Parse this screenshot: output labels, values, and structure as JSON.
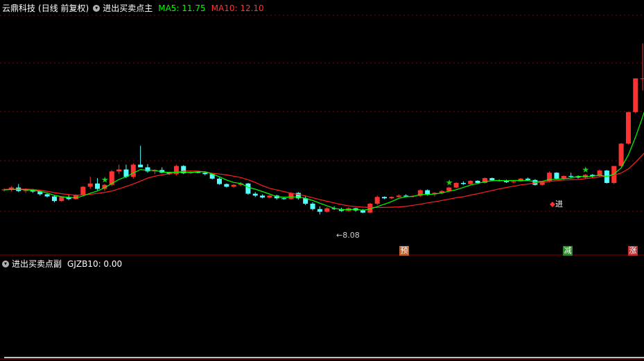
{
  "main_header": {
    "stock": "云鼎科技",
    "period": "(日线 前复权)",
    "indicator": "进出买卖点主",
    "ma5": "MA5: 11.75",
    "ma10": "MA10: 12.10"
  },
  "sub_header": {
    "indicator": "进出买卖点副",
    "value": "GJZB10: 0.00"
  },
  "annotations": {
    "low_price": "←8.08",
    "buy_label": "进",
    "tag_yu": "预",
    "tag_jian": "减",
    "tag_zhang": "涨"
  },
  "colors": {
    "up": "#ff3232",
    "down": "#54ffff",
    "ma5": "#00ff00",
    "ma10": "#ff2020",
    "grid": "#8b0000",
    "signal": "#ffff00"
  },
  "chart_data": {
    "type": "candlestick",
    "ohlc": [
      [
        9.95,
        10.02,
        9.9,
        9.98
      ],
      [
        9.98,
        10.1,
        9.9,
        10.05
      ],
      [
        10.05,
        10.18,
        9.88,
        9.92
      ],
      [
        9.92,
        10.02,
        9.85,
        9.95
      ],
      [
        9.95,
        10.0,
        9.85,
        9.9
      ],
      [
        9.9,
        9.92,
        9.75,
        9.8
      ],
      [
        9.8,
        9.82,
        9.68,
        9.72
      ],
      [
        9.72,
        9.75,
        9.5,
        9.55
      ],
      [
        9.55,
        9.72,
        9.52,
        9.7
      ],
      [
        9.7,
        9.78,
        9.58,
        9.62
      ],
      [
        9.62,
        9.8,
        9.6,
        9.78
      ],
      [
        9.78,
        10.1,
        9.75,
        10.08
      ],
      [
        10.08,
        10.45,
        10.0,
        10.2
      ],
      [
        10.2,
        10.4,
        9.95,
        10.0
      ],
      [
        10.0,
        10.18,
        9.92,
        10.15
      ],
      [
        10.15,
        10.7,
        10.1,
        10.65
      ],
      [
        10.65,
        10.9,
        10.55,
        10.72
      ],
      [
        10.72,
        10.9,
        10.4,
        10.45
      ],
      [
        10.45,
        10.95,
        10.38,
        10.9
      ],
      [
        10.9,
        11.6,
        10.8,
        10.8
      ],
      [
        10.8,
        10.92,
        10.6,
        10.65
      ],
      [
        10.65,
        10.72,
        10.55,
        10.7
      ],
      [
        10.7,
        10.8,
        10.58,
        10.6
      ],
      [
        10.6,
        10.62,
        10.52,
        10.55
      ],
      [
        10.55,
        10.9,
        10.5,
        10.85
      ],
      [
        10.85,
        10.88,
        10.55,
        10.58
      ],
      [
        10.58,
        10.65,
        10.55,
        10.62
      ],
      [
        10.62,
        10.65,
        10.58,
        10.6
      ],
      [
        10.6,
        10.62,
        10.5,
        10.55
      ],
      [
        10.55,
        10.58,
        10.35,
        10.38
      ],
      [
        10.38,
        10.42,
        10.15,
        10.18
      ],
      [
        10.18,
        10.2,
        10.05,
        10.08
      ],
      [
        10.08,
        10.18,
        10.05,
        10.15
      ],
      [
        10.15,
        10.25,
        10.1,
        10.2
      ],
      [
        10.2,
        10.22,
        9.78,
        9.82
      ],
      [
        9.82,
        9.88,
        9.7,
        9.75
      ],
      [
        9.75,
        9.8,
        9.65,
        9.68
      ],
      [
        9.68,
        9.78,
        9.65,
        9.75
      ],
      [
        9.75,
        9.78,
        9.6,
        9.65
      ],
      [
        9.65,
        9.68,
        9.6,
        9.62
      ],
      [
        9.62,
        9.88,
        9.6,
        9.85
      ],
      [
        9.85,
        9.88,
        9.6,
        9.65
      ],
      [
        9.65,
        9.72,
        9.4,
        9.45
      ],
      [
        9.45,
        9.5,
        9.2,
        9.25
      ],
      [
        9.25,
        9.35,
        9.05,
        9.15
      ],
      [
        9.15,
        9.32,
        9.12,
        9.28
      ],
      [
        9.28,
        9.35,
        9.22,
        9.25
      ],
      [
        9.25,
        9.3,
        9.15,
        9.18
      ],
      [
        9.18,
        9.32,
        9.15,
        9.28
      ],
      [
        9.28,
        9.3,
        9.15,
        9.2
      ],
      [
        9.2,
        9.25,
        9.1,
        9.12
      ],
      [
        9.12,
        9.48,
        9.1,
        9.45
      ],
      [
        9.45,
        9.75,
        9.4,
        9.7
      ],
      [
        9.7,
        9.72,
        9.62,
        9.65
      ],
      [
        9.65,
        9.72,
        9.62,
        9.7
      ],
      [
        9.7,
        9.8,
        9.68,
        9.75
      ],
      [
        9.75,
        9.8,
        9.7,
        9.72
      ],
      [
        9.72,
        9.76,
        9.68,
        9.74
      ],
      [
        9.74,
        9.98,
        9.7,
        9.95
      ],
      [
        9.95,
        9.98,
        9.75,
        9.8
      ],
      [
        9.8,
        9.88,
        9.72,
        9.85
      ],
      [
        9.85,
        9.95,
        9.8,
        9.92
      ],
      [
        9.92,
        10.08,
        9.9,
        10.05
      ],
      [
        10.05,
        10.25,
        10.02,
        10.22
      ],
      [
        10.22,
        10.28,
        10.15,
        10.18
      ],
      [
        10.18,
        10.32,
        10.16,
        10.3
      ],
      [
        10.3,
        10.32,
        10.18,
        10.22
      ],
      [
        10.22,
        10.42,
        10.2,
        10.4
      ],
      [
        10.4,
        10.42,
        10.28,
        10.32
      ],
      [
        10.32,
        10.35,
        10.28,
        10.3
      ],
      [
        10.3,
        10.34,
        10.22,
        10.25
      ],
      [
        10.25,
        10.3,
        10.2,
        10.28
      ],
      [
        10.28,
        10.4,
        10.26,
        10.38
      ],
      [
        10.38,
        10.42,
        10.3,
        10.33
      ],
      [
        10.33,
        10.36,
        10.12,
        10.15
      ],
      [
        10.15,
        10.3,
        10.12,
        10.28
      ],
      [
        10.28,
        10.65,
        10.25,
        10.6
      ],
      [
        10.6,
        10.62,
        10.35,
        10.38
      ],
      [
        10.38,
        10.5,
        10.32,
        10.48
      ],
      [
        10.48,
        10.6,
        10.4,
        10.45
      ],
      [
        10.45,
        10.5,
        10.38,
        10.42
      ],
      [
        10.42,
        10.55,
        10.38,
        10.52
      ],
      [
        10.52,
        10.55,
        10.42,
        10.48
      ],
      [
        10.48,
        10.72,
        10.45,
        10.68
      ],
      [
        10.68,
        10.7,
        10.2,
        10.22
      ],
      [
        10.22,
        10.85,
        10.18,
        10.85
      ],
      [
        10.85,
        11.7,
        10.82,
        11.68
      ],
      [
        11.68,
        12.85,
        11.65,
        12.85
      ],
      [
        12.85,
        14.1,
        12.8,
        14.1
      ],
      [
        14.1,
        15.4,
        13.65,
        14.1
      ],
      [
        14.1,
        15.7,
        14.0,
        15.4
      ],
      [
        15.4,
        15.9,
        14.6,
        14.9
      ],
      [
        14.9,
        15.2,
        13.4,
        13.5
      ],
      [
        13.5,
        15.8,
        13.2,
        15.6
      ],
      [
        15.6,
        16.4,
        15.4,
        16.0
      ],
      [
        16.0,
        16.0,
        15.3,
        15.5
      ],
      [
        15.5,
        15.8,
        15.1,
        15.2
      ],
      [
        15.2,
        15.5,
        14.8,
        14.95
      ],
      [
        14.95,
        15.3,
        14.8,
        15.1
      ],
      [
        15.1,
        16.0,
        15.0,
        15.9
      ],
      [
        15.9,
        16.3,
        15.4,
        15.6
      ]
    ],
    "ma5": [
      9.96,
      9.98,
      9.98,
      9.97,
      9.95,
      9.91,
      9.85,
      9.76,
      9.71,
      9.68,
      9.67,
      9.74,
      9.84,
      9.92,
      10.04,
      10.2,
      10.35,
      10.45,
      10.59,
      10.72,
      10.69,
      10.69,
      10.63,
      10.61,
      10.62,
      10.62,
      10.61,
      10.63,
      10.64,
      10.55,
      10.45,
      10.33,
      10.24,
      10.2,
      10.06,
      9.99,
      9.9,
      9.81,
      9.71,
      9.69,
      9.7,
      9.7,
      9.65,
      9.57,
      9.47,
      9.37,
      9.28,
      9.23,
      9.23,
      9.24,
      9.21,
      9.25,
      9.34,
      9.43,
      9.53,
      9.65,
      9.71,
      9.72,
      9.79,
      9.79,
      9.81,
      9.85,
      9.91,
      9.97,
      10.05,
      10.14,
      10.2,
      10.27,
      10.3,
      10.31,
      10.3,
      10.31,
      10.31,
      10.31,
      10.27,
      10.28,
      10.35,
      10.35,
      10.38,
      10.4,
      10.47,
      10.45,
      10.47,
      10.51,
      10.46,
      10.55,
      10.78,
      11.26,
      11.92,
      12.68,
      13.47,
      14.04,
      14.38,
      14.59,
      14.74,
      14.85,
      15.02,
      15.16,
      15.15,
      15.29,
      15.27
    ],
    "ma10": [
      9.98,
      9.99,
      9.99,
      9.99,
      9.98,
      9.95,
      9.91,
      9.86,
      9.82,
      9.79,
      9.76,
      9.78,
      9.8,
      9.83,
      9.87,
      9.92,
      10.0,
      10.09,
      10.18,
      10.29,
      10.4,
      10.47,
      10.52,
      10.56,
      10.61,
      10.66,
      10.66,
      10.66,
      10.63,
      10.58,
      10.55,
      10.52,
      10.47,
      10.42,
      10.34,
      10.24,
      10.12,
      10.02,
      9.96,
      9.9,
      9.84,
      9.79,
      9.74,
      9.67,
      9.6,
      9.54,
      9.48,
      9.42,
      9.37,
      9.34,
      9.32,
      9.31,
      9.31,
      9.31,
      9.32,
      9.33,
      9.35,
      9.39,
      9.43,
      9.48,
      9.52,
      9.57,
      9.62,
      9.67,
      9.71,
      9.77,
      9.82,
      9.88,
      9.94,
      10.0,
      10.05,
      10.1,
      10.15,
      10.18,
      10.22,
      10.25,
      10.28,
      10.3,
      10.33,
      10.34,
      10.35,
      10.38,
      10.41,
      10.45,
      10.47,
      10.51,
      10.59,
      10.74,
      10.99,
      11.27,
      11.55,
      11.85,
      12.08,
      12.31,
      12.52,
      12.76,
      12.99,
      13.18,
      13.31,
      13.5,
      13.69
    ],
    "signal_index": 94,
    "sub_series": {
      "name": "GJZB10",
      "values": [
        0,
        0,
        0,
        0,
        0,
        0,
        0,
        0,
        0,
        0,
        0,
        0,
        0,
        0,
        0,
        0,
        0,
        0,
        0,
        0,
        0,
        0,
        0,
        0,
        0,
        0,
        0,
        0,
        0,
        0,
        0,
        0,
        0,
        0,
        0,
        0,
        0,
        0,
        0,
        0,
        0,
        0,
        0,
        0,
        0,
        0,
        0,
        0,
        0,
        0,
        0,
        0,
        0,
        0,
        0,
        0,
        0,
        0,
        0,
        0,
        0,
        0,
        0,
        0,
        0,
        0,
        0,
        0,
        0,
        0,
        0,
        0,
        0,
        0,
        0,
        0,
        0,
        0,
        0,
        0,
        0,
        0,
        0,
        0,
        0,
        0,
        0,
        0,
        0,
        0,
        0,
        0,
        0,
        0,
        0,
        1,
        0,
        0,
        0,
        0,
        0
      ]
    }
  }
}
